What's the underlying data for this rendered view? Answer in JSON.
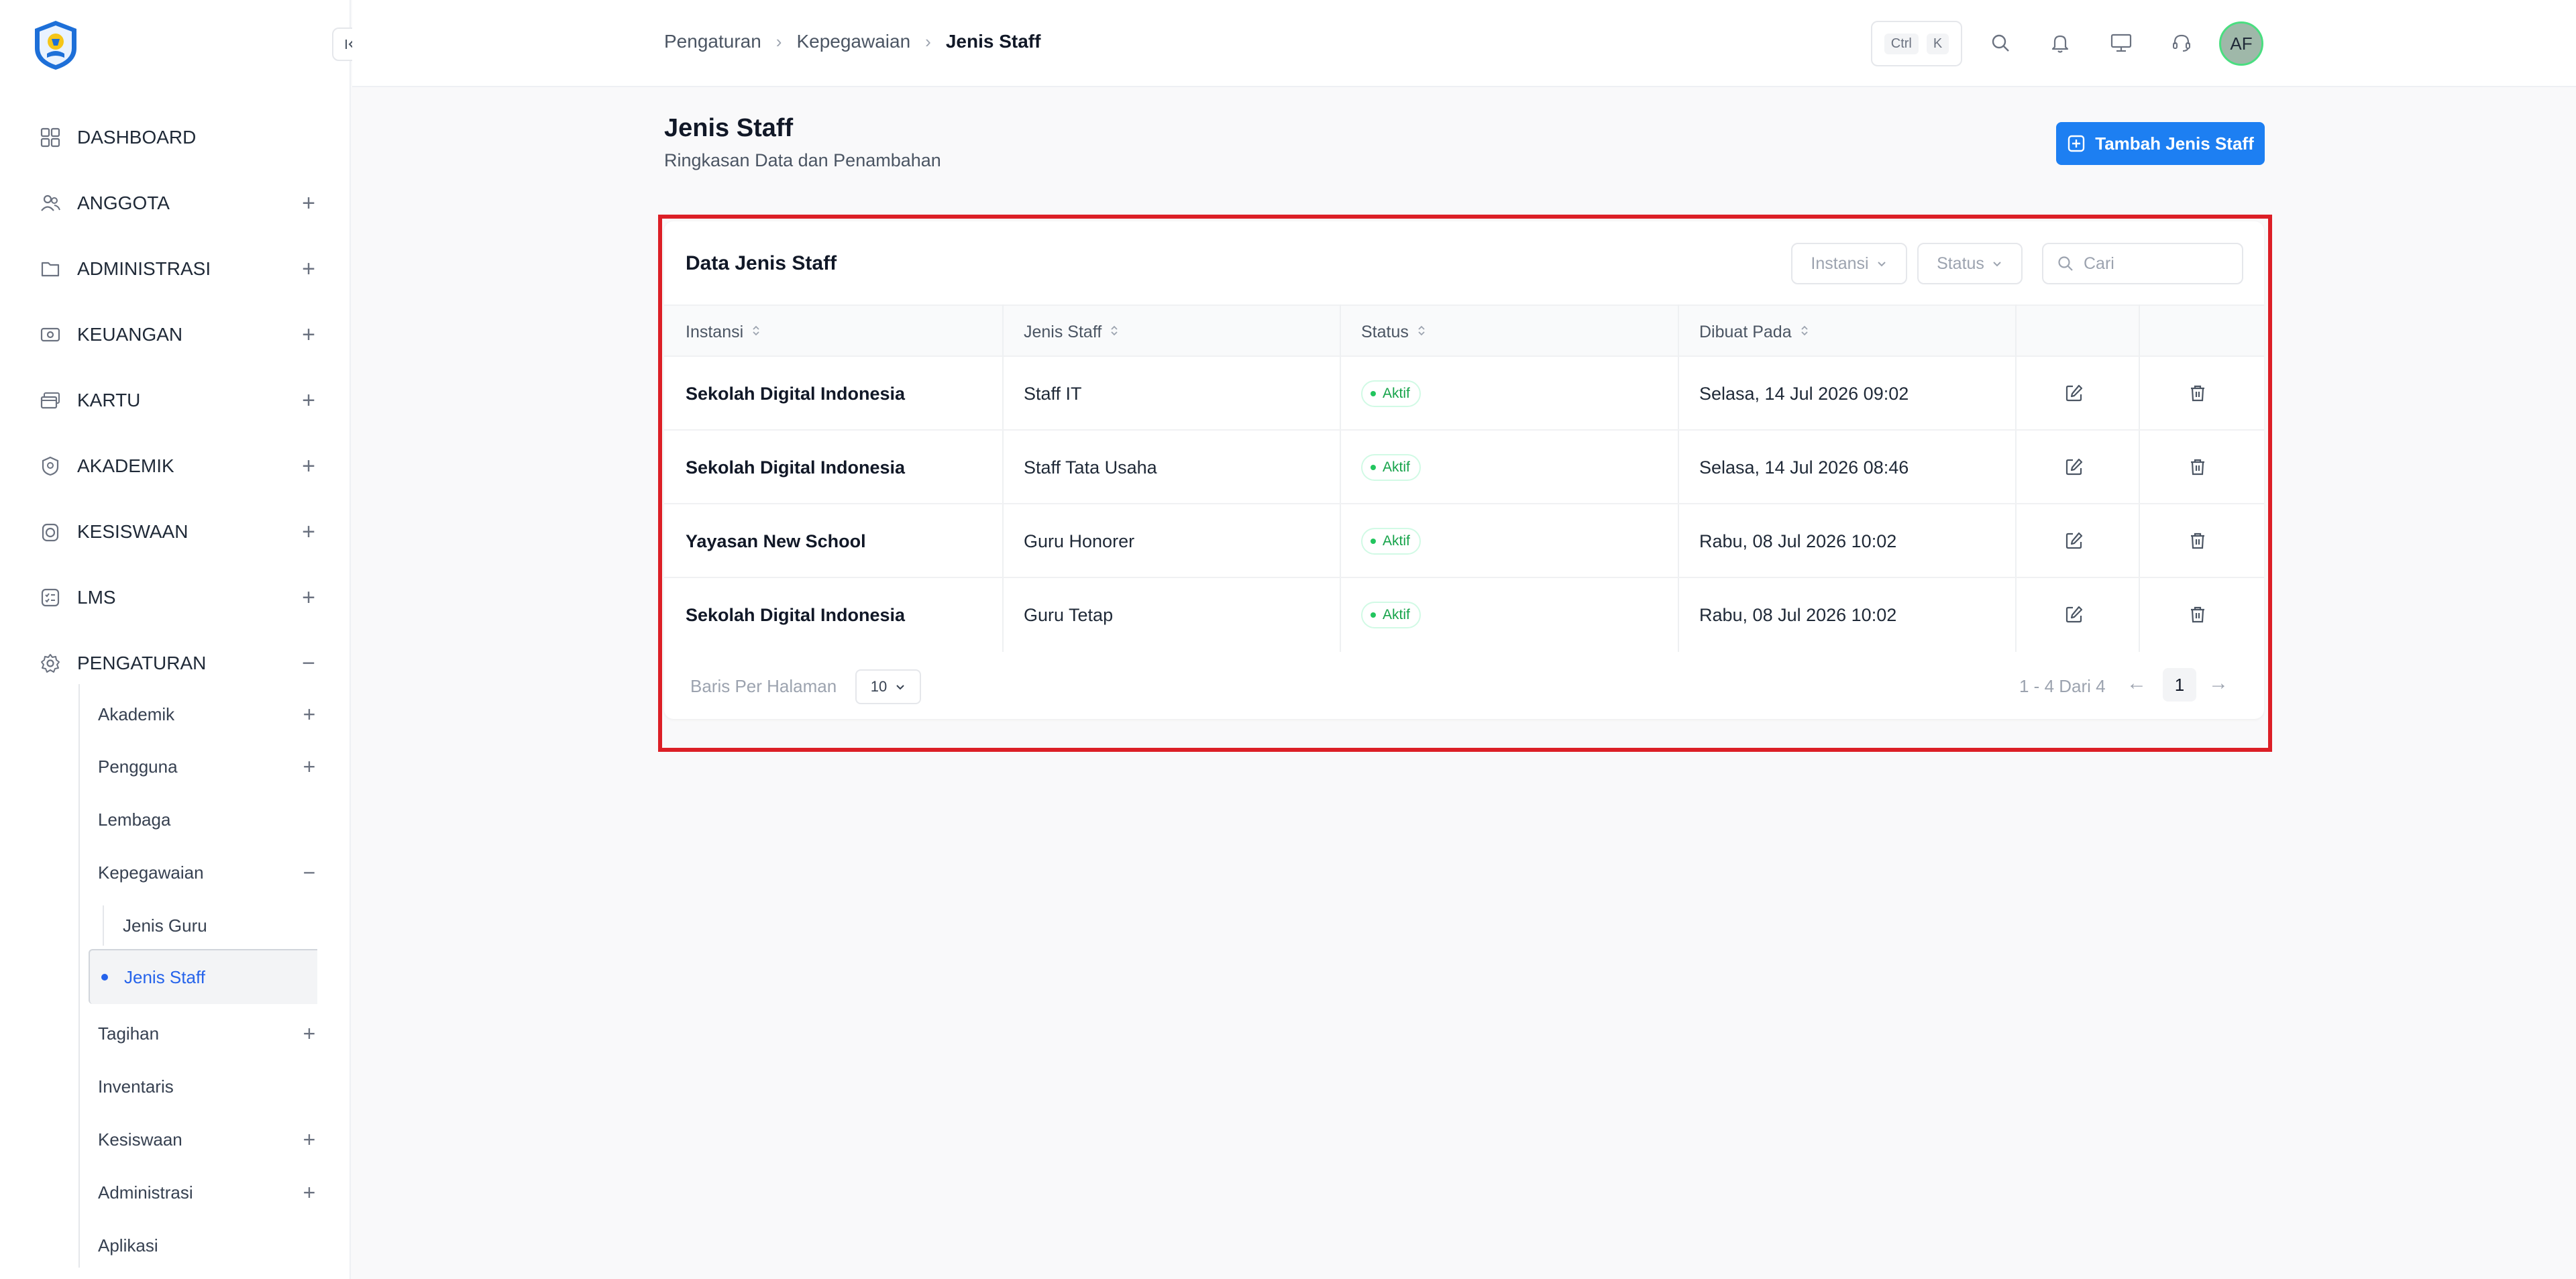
{
  "sidebar": {
    "menu": [
      {
        "label": "DASHBOARD",
        "toggle": ""
      },
      {
        "label": "ANGGOTA",
        "toggle": "+"
      },
      {
        "label": "ADMINISTRASI",
        "toggle": "+"
      },
      {
        "label": "KEUANGAN",
        "toggle": "+"
      },
      {
        "label": "KARTU",
        "toggle": "+"
      },
      {
        "label": "AKADEMIK",
        "toggle": "+"
      },
      {
        "label": "KESISWAAN",
        "toggle": "+"
      },
      {
        "label": "LMS",
        "toggle": "+"
      },
      {
        "label": "PENGATURAN",
        "toggle": "−"
      }
    ],
    "submenu": [
      {
        "label": "Akademik",
        "toggle": "+"
      },
      {
        "label": "Pengguna",
        "toggle": "+"
      },
      {
        "label": "Lembaga",
        "toggle": ""
      },
      {
        "label": "Kepegawaian",
        "toggle": "−"
      }
    ],
    "subsub": {
      "jenis_guru": "Jenis Guru",
      "jenis_staff": "Jenis Staff"
    },
    "submenu_after": [
      {
        "label": "Tagihan",
        "toggle": "+"
      },
      {
        "label": "Inventaris",
        "toggle": ""
      },
      {
        "label": "Kesiswaan",
        "toggle": "+"
      },
      {
        "label": "Administrasi",
        "toggle": "+"
      },
      {
        "label": "Aplikasi",
        "toggle": ""
      }
    ]
  },
  "header": {
    "breadcrumb": [
      "Pengaturan",
      "Kepegawaian",
      "Jenis Staff"
    ],
    "shortcut": {
      "ctrl": "Ctrl",
      "key": "K"
    },
    "avatar_initials": "AF"
  },
  "page": {
    "title": "Jenis Staff",
    "subtitle": "Ringkasan Data dan Penambahan",
    "add_button": "Tambah Jenis Staff"
  },
  "card": {
    "title": "Data Jenis Staff",
    "filters": {
      "instansi": "Instansi",
      "status": "Status"
    },
    "search_placeholder": "Cari",
    "columns": [
      "Instansi",
      "Jenis Staff",
      "Status",
      "Dibuat Pada"
    ],
    "rows": [
      {
        "instansi": "Sekolah Digital Indonesia",
        "jenis": "Staff IT",
        "status": "Aktif",
        "dibuat": "Selasa, 14 Jul 2026 09:02"
      },
      {
        "instansi": "Sekolah Digital Indonesia",
        "jenis": "Staff Tata Usaha",
        "status": "Aktif",
        "dibuat": "Selasa, 14 Jul 2026 08:46"
      },
      {
        "instansi": "Yayasan New School",
        "jenis": "Guru Honorer",
        "status": "Aktif",
        "dibuat": "Rabu, 08 Jul 2026 10:02"
      },
      {
        "instansi": "Sekolah Digital Indonesia",
        "jenis": "Guru Tetap",
        "status": "Aktif",
        "dibuat": "Rabu, 08 Jul 2026 10:02"
      }
    ],
    "pagination": {
      "rows_per_page_label": "Baris Per Halaman",
      "rows_per_page": "10",
      "range": "1 - 4 Dari 4",
      "prev": "←",
      "current_page": "1",
      "next": "→"
    }
  },
  "colors": {
    "primary": "#1d7ff2",
    "active": "#2563eb",
    "success": "#16a34a",
    "highlight": "#dc1f26"
  }
}
